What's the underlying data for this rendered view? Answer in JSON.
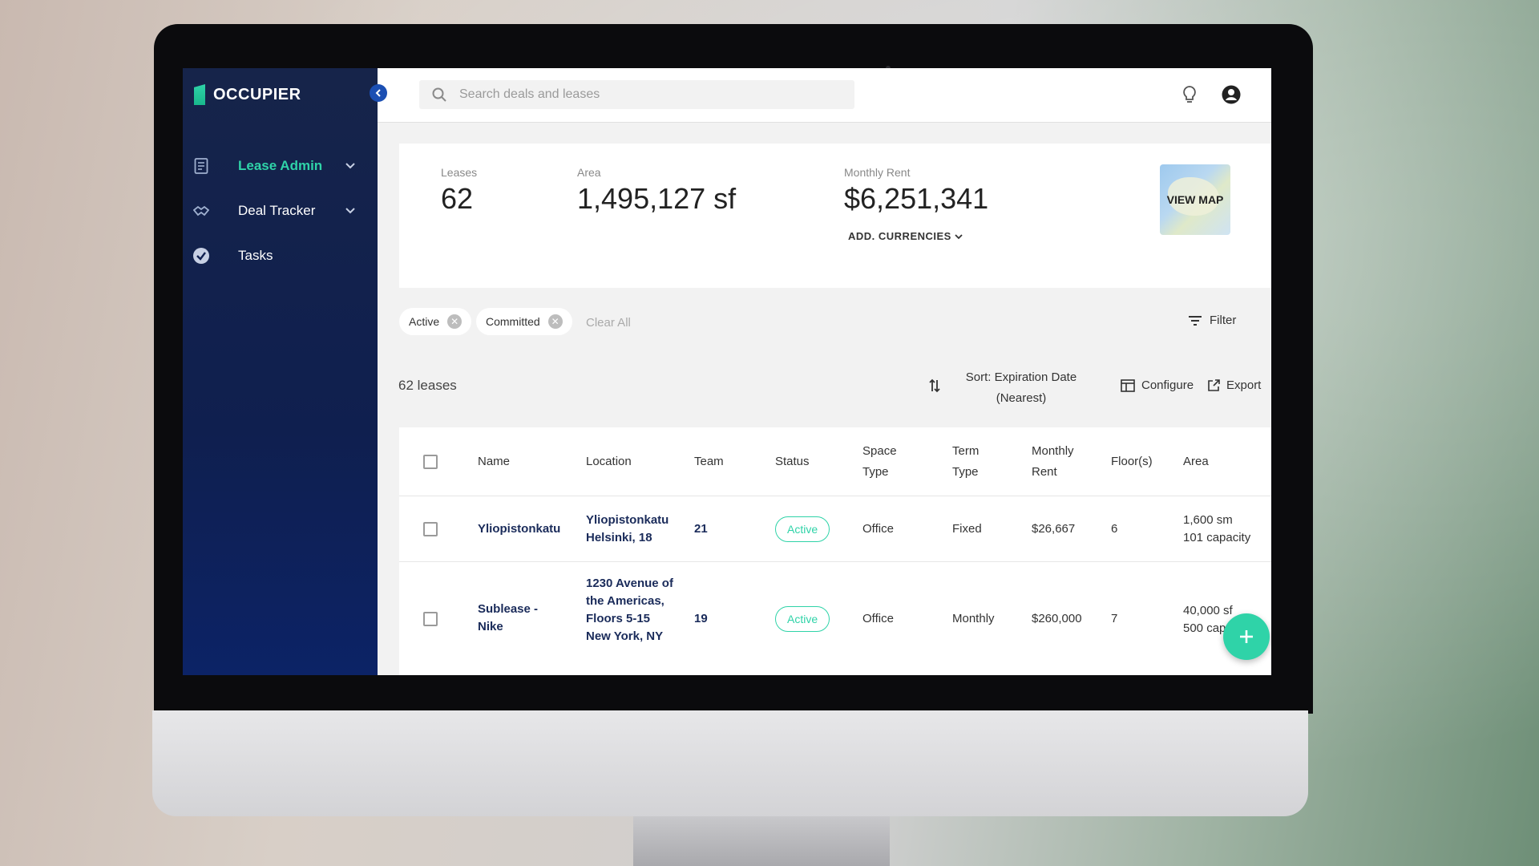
{
  "app": {
    "logo_text": "OCCUPIER"
  },
  "sidebar": {
    "items": [
      {
        "label": "Lease Admin",
        "icon": "document-icon",
        "has_chevron": true,
        "active": true
      },
      {
        "label": "Deal Tracker",
        "icon": "handshake-icon",
        "has_chevron": true,
        "active": false
      },
      {
        "label": "Tasks",
        "icon": "check-circle-icon",
        "has_chevron": false,
        "active": false
      }
    ]
  },
  "search": {
    "placeholder": "Search deals and leases"
  },
  "stats": {
    "leases_label": "Leases",
    "leases_value": "62",
    "area_label": "Area",
    "area_value": "1,495,127 sf",
    "rent_label": "Monthly Rent",
    "rent_value": "$6,251,341",
    "add_currencies": "ADD. CURRENCIES",
    "view_map": "VIEW MAP"
  },
  "filters": {
    "chips": [
      "Active",
      "Committed"
    ],
    "clear_all": "Clear All",
    "filter_label": "Filter"
  },
  "toolbar": {
    "count": "62 leases",
    "sort_label": "Sort: Expiration Date (Nearest)",
    "configure": "Configure",
    "export": "Export"
  },
  "table": {
    "headers": [
      "Name",
      "Location",
      "Team",
      "Status",
      "Space Type",
      "Term Type",
      "Monthly Rent",
      "Floor(s)",
      "Area"
    ],
    "rows": [
      {
        "name": "Yliopistonkatu",
        "location": "Yliopistonkatu Helsinki, 18",
        "team": "21",
        "status": "Active",
        "space_type": "Office",
        "term_type": "Fixed",
        "monthly_rent": "$26,667",
        "floors": "6",
        "area": "1,600 sm",
        "capacity": "101 capacity"
      },
      {
        "name": "Sublease - Nike",
        "location": "1230 Avenue of the Americas, Floors 5-15 New York, NY",
        "team": "19",
        "status": "Active",
        "space_type": "Office",
        "term_type": "Monthly",
        "monthly_rent": "$260,000",
        "floors": "7",
        "area": "40,000 sf",
        "capacity": "500 cap"
      }
    ]
  },
  "colors": {
    "sidebar_bg": "#0f1f4f",
    "accent": "#2fd3a8"
  }
}
